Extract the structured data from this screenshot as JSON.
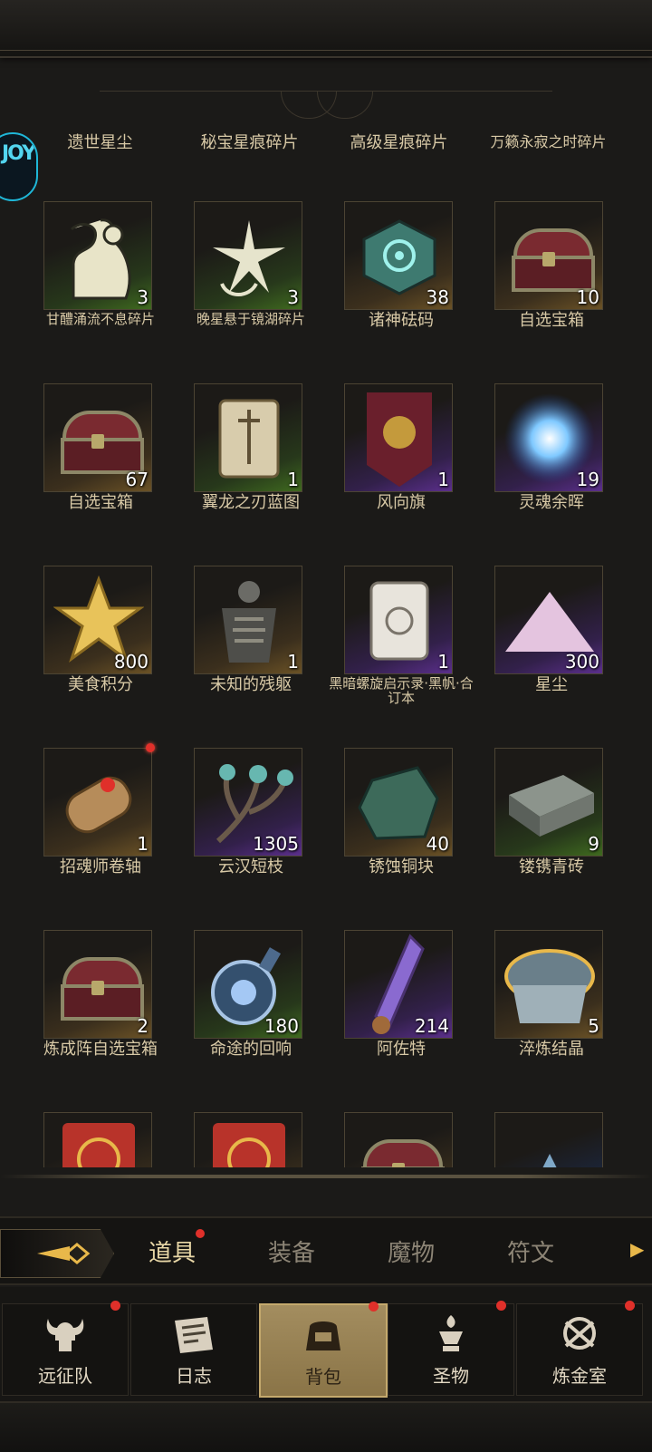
{
  "header_labels": [
    "遗世星尘",
    "秘宝星痕碎片",
    "高级星痕碎片",
    "万籁永寂之时碎片"
  ],
  "items": [
    {
      "name": "甘醴涌流不息碎片",
      "count": "3",
      "rarity": "green",
      "icon": "figure-icon"
    },
    {
      "name": "晚星悬于镜湖碎片",
      "count": "3",
      "rarity": "green",
      "icon": "star-burst-icon"
    },
    {
      "name": "诸神砝码",
      "count": "38",
      "rarity": "gold",
      "icon": "rune-cube-icon"
    },
    {
      "name": "自选宝箱",
      "count": "10",
      "rarity": "gold",
      "icon": "chest-icon"
    },
    {
      "name": "自选宝箱",
      "count": "67",
      "rarity": "gold",
      "icon": "chest-icon"
    },
    {
      "name": "翼龙之刃蓝图",
      "count": "1",
      "rarity": "green",
      "icon": "scroll-sword-icon"
    },
    {
      "name": "风向旗",
      "count": "1",
      "rarity": "purple",
      "icon": "banner-icon"
    },
    {
      "name": "灵魂余晖",
      "count": "19",
      "rarity": "purple",
      "icon": "soul-orb-icon"
    },
    {
      "name": "美食积分",
      "count": "800",
      "rarity": "gold",
      "icon": "gold-star-icon"
    },
    {
      "name": "未知的残躯",
      "count": "1",
      "rarity": "gold",
      "icon": "remains-icon"
    },
    {
      "name": "黑暗螺旋启示录·黑帆·合订本",
      "count": "1",
      "rarity": "purple",
      "icon": "scroll-icon"
    },
    {
      "name": "星尘",
      "count": "300",
      "rarity": "purple",
      "icon": "stardust-icon"
    },
    {
      "name": "招魂师卷轴",
      "count": "1",
      "rarity": "gold",
      "icon": "summon-scroll-icon",
      "badge": true
    },
    {
      "name": "云汉短枝",
      "count": "1305",
      "rarity": "purple",
      "icon": "branch-icon"
    },
    {
      "name": "锈蚀铜块",
      "count": "40",
      "rarity": "gold",
      "icon": "copper-ore-icon"
    },
    {
      "name": "镂镌青砖",
      "count": "9",
      "rarity": "green",
      "icon": "brick-icon"
    },
    {
      "name": "炼成阵自选宝箱",
      "count": "2",
      "rarity": "gold",
      "icon": "chest-icon"
    },
    {
      "name": "命途的回响",
      "count": "180",
      "rarity": "green",
      "icon": "potion-icon"
    },
    {
      "name": "阿佐特",
      "count": "214",
      "rarity": "purple",
      "icon": "crystal-vial-icon"
    },
    {
      "name": "淬炼结晶",
      "count": "5",
      "rarity": "gold",
      "icon": "crystal-plate-icon"
    },
    {
      "name": "",
      "count": "",
      "rarity": "gold",
      "icon": "red-envelope-icon"
    },
    {
      "name": "",
      "count": "",
      "rarity": "gold",
      "icon": "red-envelope-icon"
    },
    {
      "name": "",
      "count": "",
      "rarity": "gold",
      "icon": "chest-icon"
    },
    {
      "name": "",
      "count": "",
      "rarity": "blue",
      "icon": "crystal-icon"
    }
  ],
  "tabs": [
    {
      "label": "道具",
      "active": true,
      "badge": true
    },
    {
      "label": "装备",
      "active": false,
      "badge": false
    },
    {
      "label": "魔物",
      "active": false,
      "badge": false
    },
    {
      "label": "符文",
      "active": false,
      "badge": false
    }
  ],
  "nav": [
    {
      "label": "远征队",
      "icon": "horned-helmet-icon",
      "badge": true,
      "active": false
    },
    {
      "label": "日志",
      "icon": "journal-icon",
      "badge": false,
      "active": false
    },
    {
      "label": "背包",
      "icon": "backpack-icon",
      "badge": true,
      "active": true
    },
    {
      "label": "圣物",
      "icon": "relic-icon",
      "badge": true,
      "active": false
    },
    {
      "label": "炼金室",
      "icon": "alchemy-icon",
      "badge": true,
      "active": false
    }
  ],
  "float_bubble": {
    "text": "JOY"
  }
}
